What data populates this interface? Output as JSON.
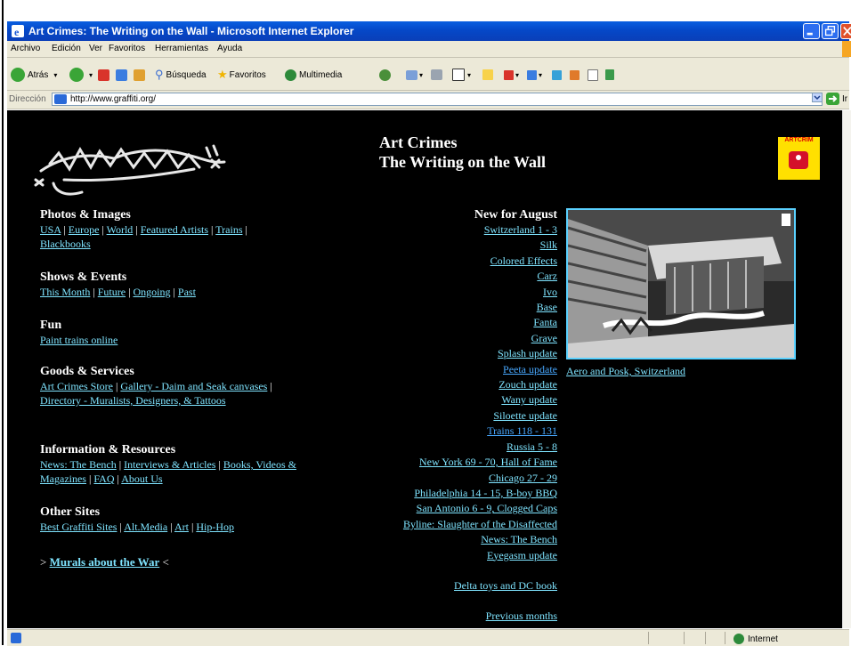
{
  "window": {
    "title": "Art Crimes: The Writing on the Wall - Microsoft Internet Explorer"
  },
  "menu": [
    "Archivo",
    "Edición",
    "Ver",
    "Favoritos",
    "Herramientas",
    "Ayuda"
  ],
  "toolbar": {
    "back": "Atrás",
    "search": "Búsqueda",
    "favorites": "Favoritos",
    "media": "Multimedia"
  },
  "address": {
    "label": "Dirección",
    "url": "http://www.graffiti.org/",
    "go": "Ir"
  },
  "page": {
    "title_line1": "Art Crimes",
    "title_line2": "The Writing on the Wall",
    "badge_text": "ARTCRIM",
    "sections": [
      {
        "heading": "Photos & Images",
        "links": [
          "USA",
          "Europe",
          "World",
          "Featured Artists",
          "Trains",
          "Blackbooks"
        ]
      },
      {
        "heading": "Shows & Events",
        "links": [
          "This Month",
          "Future",
          "Ongoing",
          "Past"
        ]
      },
      {
        "heading": "Fun",
        "links": [
          "Paint trains online"
        ]
      },
      {
        "heading": "Goods & Services",
        "links": [
          "Art Crimes Store",
          "Gallery - Daim and Seak canvases",
          "Directory - Muralists, Designers, & Tattoos"
        ]
      },
      {
        "heading": "Information & Resources",
        "links": [
          "News: The Bench",
          "Interviews & Articles",
          "Books, Videos & Magazines",
          "FAQ",
          "About Us"
        ]
      },
      {
        "heading": "Other Sites",
        "links": [
          "Best Graffiti Sites",
          "Alt.Media",
          "Art",
          "Hip-Hop"
        ]
      }
    ],
    "murals": {
      "prefix": ">",
      "link": "Murals about the War",
      "suffix": "<"
    },
    "new_heading": "New for August",
    "new_items": [
      "Switzerland 1 - 3",
      "Silk",
      "Colored Effects",
      "Carz",
      "Ivo",
      "Base",
      "Fanta",
      "Grave",
      "Splash update",
      "Peeta update",
      "Zouch update",
      "Wany update",
      "Siloette update",
      "Trains 118 - 131",
      "Russia 5 - 8",
      "New York 69 - 70, Hall of Fame",
      "Chicago 27 - 29",
      "Philadelphia 14 - 15, B-boy BBQ",
      "San Antonio 6 - 9, Clogged Caps",
      "Byline: Slaughter of the Disaffected",
      "News: The Bench",
      "Eyegasm update"
    ],
    "delta": "Delta toys and DC book",
    "previous": "Previous months",
    "photo_caption": "Aero and Posk, Switzerland"
  },
  "status": {
    "zone": "Internet"
  }
}
